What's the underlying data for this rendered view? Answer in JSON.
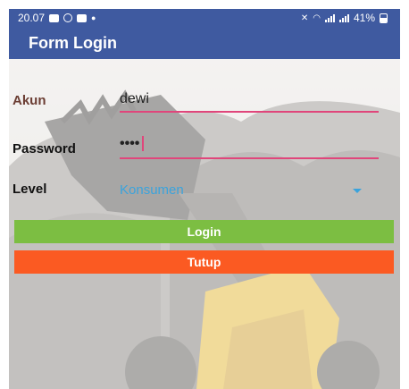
{
  "status_bar": {
    "time": "20.07",
    "battery": "41%"
  },
  "app_bar": {
    "title": "Form Login"
  },
  "form": {
    "akun": {
      "label": "Akun",
      "value": "dewi"
    },
    "password": {
      "label": "Password",
      "masked_value": "••••"
    },
    "level": {
      "label": "Level",
      "selected": "Konsumen"
    }
  },
  "buttons": {
    "login": "Login",
    "tutup": "Tutup"
  },
  "colors": {
    "app_bar": "#3f5aa0",
    "accent_underline": "#e0467b",
    "spinner_text": "#3ba3dc",
    "login_button": "#7cbe42",
    "tutup_button": "#fb5a22"
  }
}
